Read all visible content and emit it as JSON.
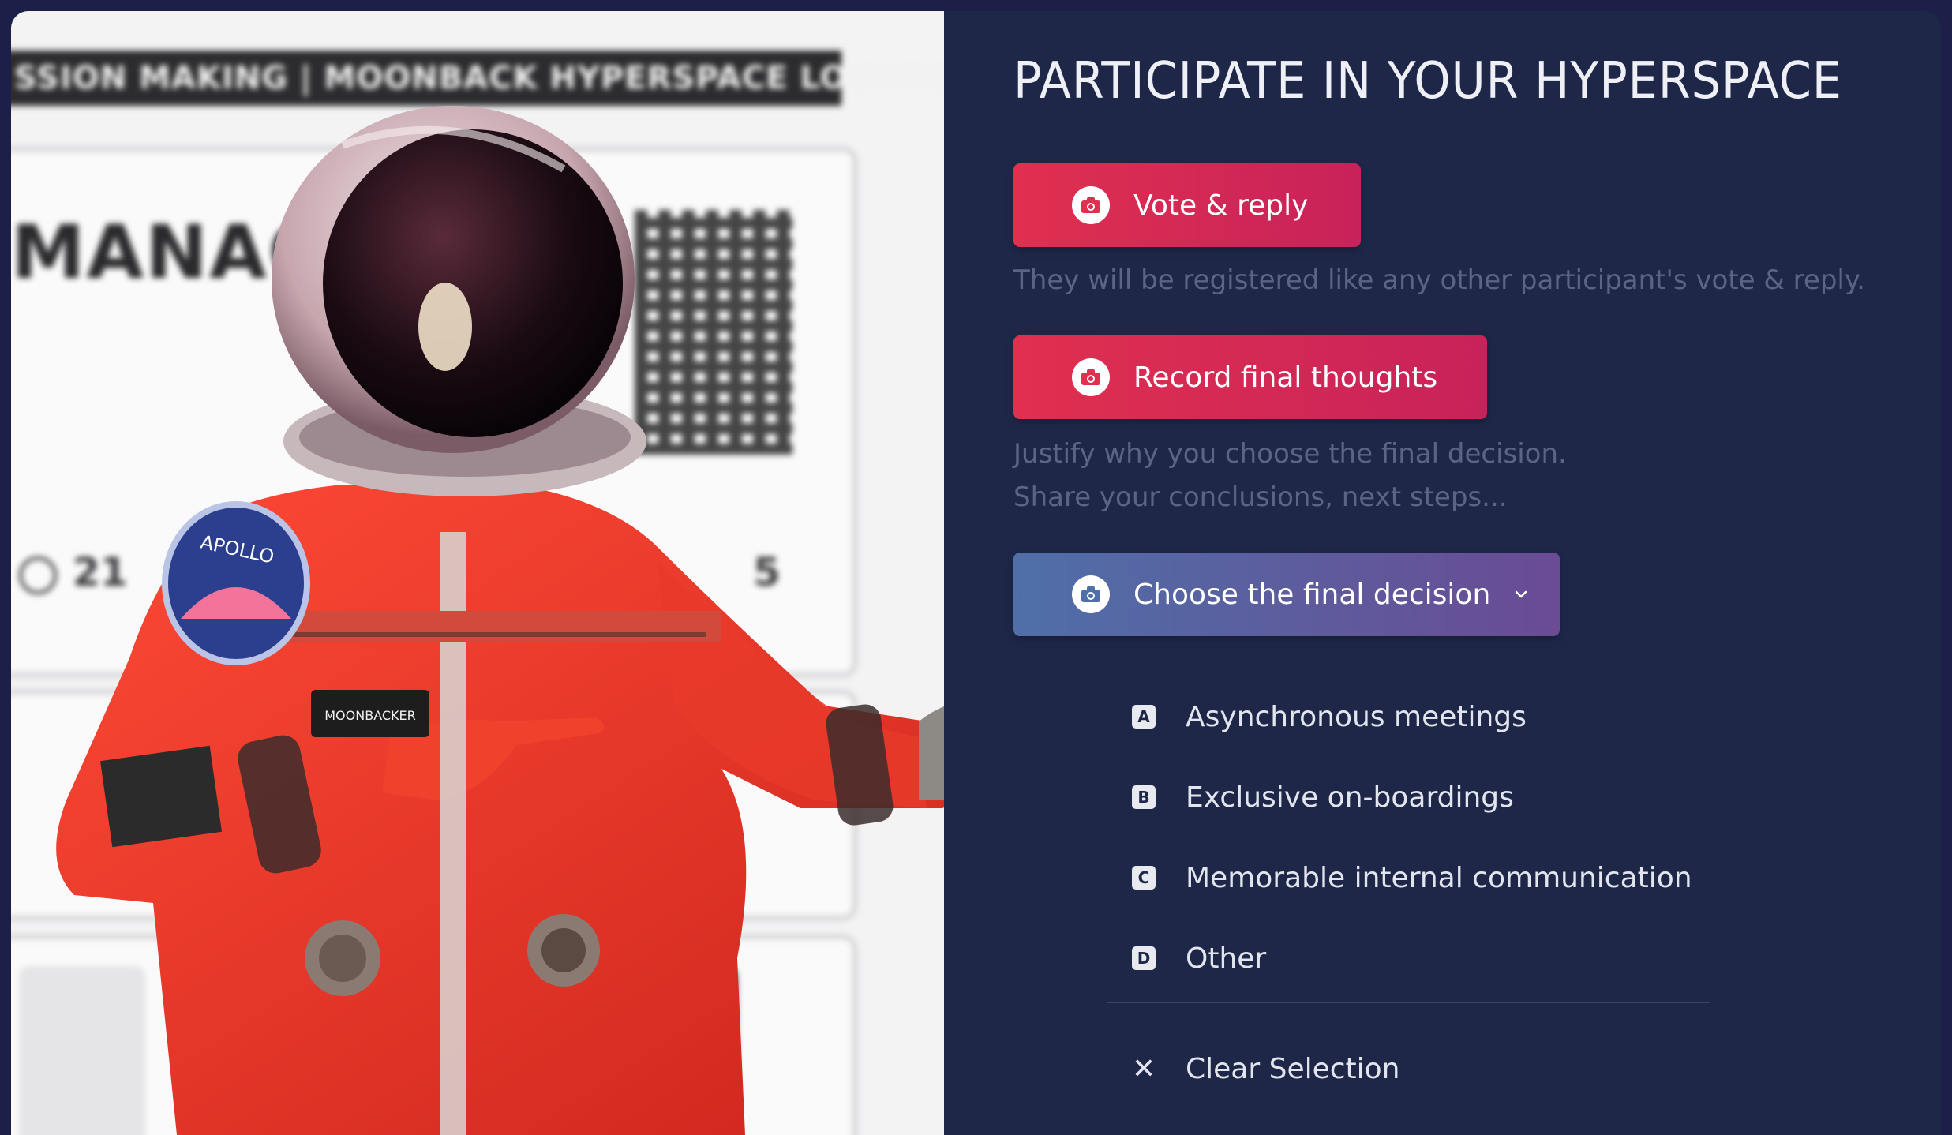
{
  "logbook": {
    "header": "SSION MAKING | MOONBACK HYPERSPACE LOGBOOK",
    "title": "MANAGEM",
    "stats": [
      "21",
      "5"
    ]
  },
  "astronaut": {
    "patch_text": "APOLLO",
    "name_tag": "MOONBACKER"
  },
  "panel": {
    "title": "PARTICIPATE IN YOUR HYPERSPACE",
    "vote_button": {
      "label": "Vote & reply",
      "icon": "camera-icon",
      "help": "They will be registered like any other participant's vote & reply."
    },
    "record_button": {
      "label": "Record final thoughts",
      "icon": "camera-icon",
      "help_lines": [
        "Justify why you choose the final decision.",
        "Share your conclusions, next steps..."
      ]
    },
    "choose_button": {
      "label": "Choose the final decision",
      "icon": "camera-icon",
      "dropdown_icon": "chevron-down-icon"
    },
    "options": [
      {
        "key": "A",
        "label": "Asynchronous meetings"
      },
      {
        "key": "B",
        "label": "Exclusive on-boardings"
      },
      {
        "key": "C",
        "label": "Memorable internal communication"
      },
      {
        "key": "D",
        "label": "Other"
      }
    ],
    "clear": {
      "label": "Clear Selection",
      "icon": "close-icon"
    }
  },
  "colors": {
    "background": "#1c1f47",
    "panel": "#1f2749",
    "button_red": "#e0304f",
    "button_blue": "#4f6fa8",
    "button_purple": "#6a4b94",
    "muted_text": "#5b6484"
  }
}
